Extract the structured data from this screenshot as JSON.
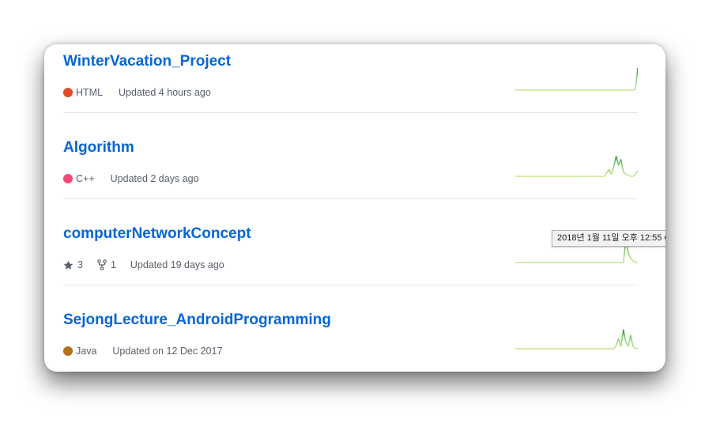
{
  "repos": [
    {
      "name": "WinterVacation_Project",
      "language": "HTML",
      "language_color": "#e34c26",
      "stars": null,
      "forks": null,
      "updated": "Updated 4 hours ago",
      "activity": [
        0,
        0,
        0,
        0,
        0,
        0,
        0,
        0,
        0,
        0,
        0,
        0,
        0,
        0,
        0,
        0,
        0,
        0,
        0,
        0,
        0,
        0,
        0,
        0,
        0,
        0,
        0,
        0,
        0,
        0,
        0,
        0,
        0,
        0,
        0,
        0,
        0,
        0,
        0,
        0,
        0,
        0,
        0,
        0,
        0,
        0,
        0,
        0,
        0,
        0,
        0.05,
        1
      ]
    },
    {
      "name": "Algorithm",
      "language": "C++",
      "language_color": "#f34b7d",
      "stars": null,
      "forks": null,
      "updated": "Updated 2 days ago",
      "activity": [
        0,
        0,
        0,
        0,
        0,
        0,
        0,
        0,
        0,
        0,
        0,
        0,
        0,
        0,
        0,
        0,
        0,
        0,
        0,
        0,
        0,
        0,
        0,
        0,
        0,
        0,
        0,
        0,
        0,
        0,
        0,
        0,
        0,
        0,
        0,
        0,
        0,
        0,
        0.15,
        0.3,
        0.1,
        0.45,
        0.9,
        0.5,
        0.75,
        0.2,
        0.1,
        0.05,
        0,
        0,
        0.1,
        0.25
      ]
    },
    {
      "name": "computerNetworkConcept",
      "language": null,
      "language_color": null,
      "stars": "3",
      "forks": "1",
      "updated": "Updated 19 days ago",
      "activity": [
        0,
        0,
        0,
        0,
        0,
        0,
        0,
        0,
        0,
        0,
        0,
        0,
        0,
        0,
        0,
        0,
        0,
        0,
        0,
        0,
        0,
        0,
        0,
        0,
        0,
        0,
        0,
        0,
        0,
        0,
        0,
        0,
        0,
        0,
        0,
        0,
        0,
        0,
        0,
        0,
        0,
        0,
        0,
        0,
        0,
        0,
        1,
        0.45,
        0.2,
        0.08,
        0.02,
        0
      ]
    },
    {
      "name": "SejongLecture_AndroidProgramming",
      "language": "Java",
      "language_color": "#b07219",
      "stars": null,
      "forks": null,
      "updated": "Updated on 12 Dec 2017",
      "activity": [
        0,
        0,
        0,
        0,
        0,
        0,
        0,
        0,
        0,
        0,
        0,
        0,
        0,
        0,
        0,
        0,
        0,
        0,
        0,
        0,
        0,
        0,
        0,
        0,
        0,
        0,
        0,
        0,
        0,
        0,
        0,
        0,
        0,
        0,
        0,
        0,
        0,
        0,
        0,
        0,
        0,
        0,
        0.15,
        0.45,
        0.1,
        0.85,
        0.3,
        0.1,
        0.6,
        0.1,
        0,
        0
      ]
    }
  ],
  "tooltip": {
    "text": "2018년 1월 11일 오후 12:55 G"
  },
  "colors": {
    "link": "#0366d6",
    "meta": "#586069",
    "spark_stroke": "#c6e48b",
    "spark_peak": "#7bc96f"
  }
}
